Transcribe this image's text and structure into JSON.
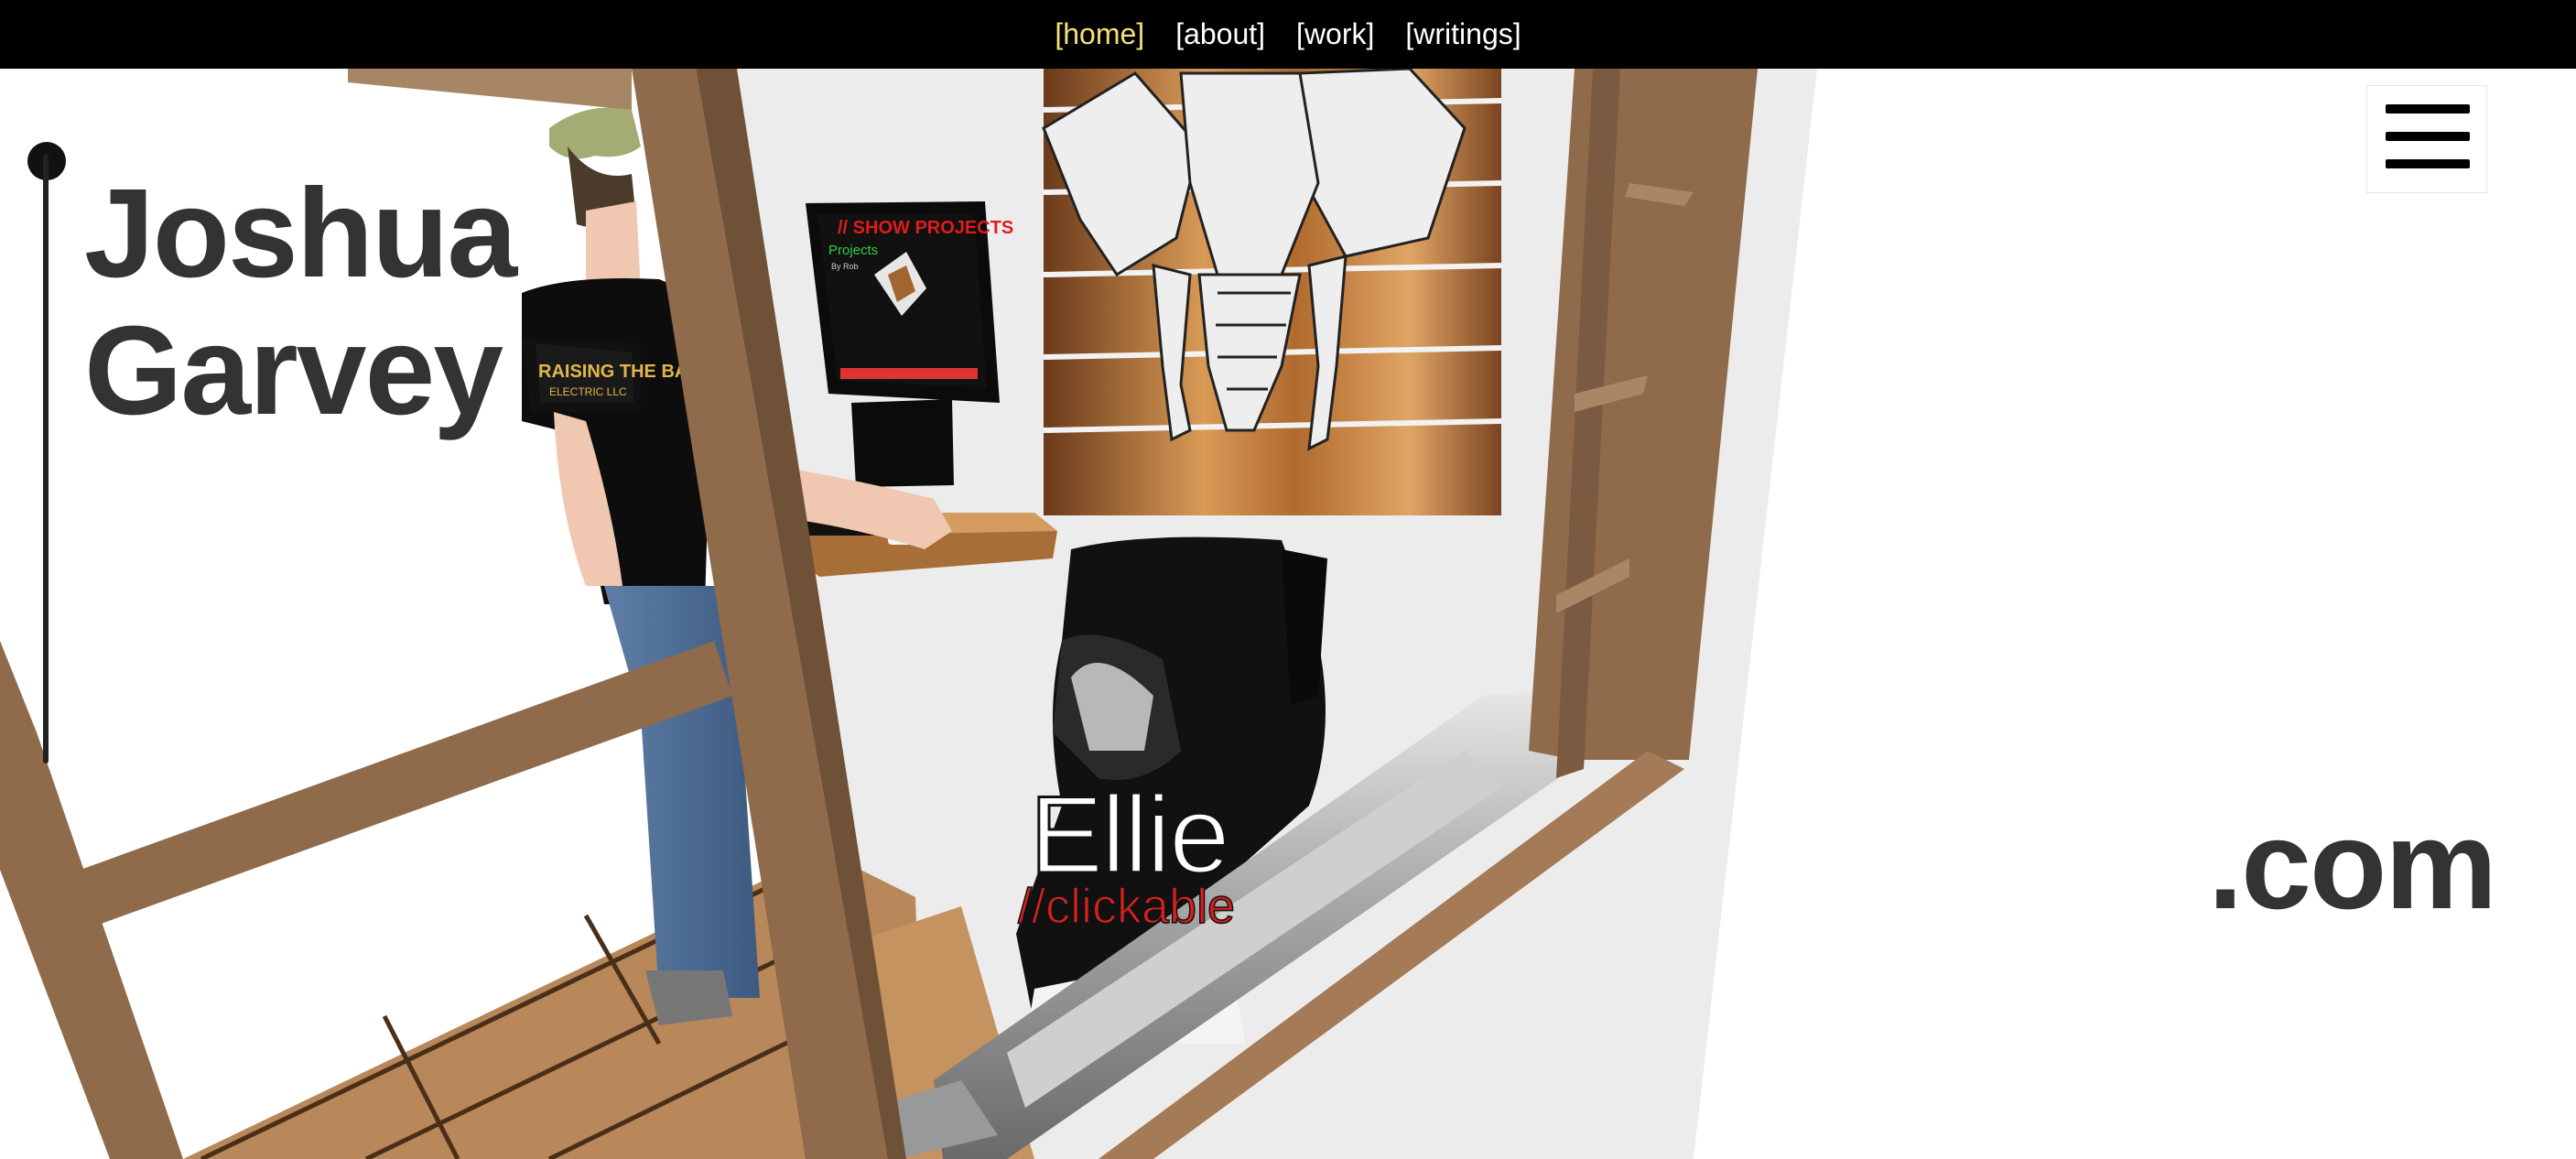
{
  "nav": {
    "items": [
      "[home]",
      "[about]",
      "[work]",
      "[writings]"
    ],
    "active_index": 0,
    "active_color": "#f3e27a"
  },
  "hero": {
    "name_line1": "Joshua",
    "name_line2": "Garvey",
    "domain_suffix": ".com"
  },
  "menu": {
    "icon": "hamburger-menu-icon"
  },
  "scene": {
    "monitor_heading": "// SHOW PROJECTS",
    "monitor_sub": "Projects",
    "monitor_byline": "By Rob",
    "shirt_text_line1": "RAISING THE BAR",
    "shirt_text_line2": "ELECTRIC LLC",
    "dog_label": "Ellie",
    "dog_hint": "//clickable"
  },
  "colors": {
    "topbar": "#000000",
    "text_dark": "#333333",
    "hint_red": "#d8201f",
    "wood": "#8f6a4b",
    "wall": "#ececec"
  }
}
